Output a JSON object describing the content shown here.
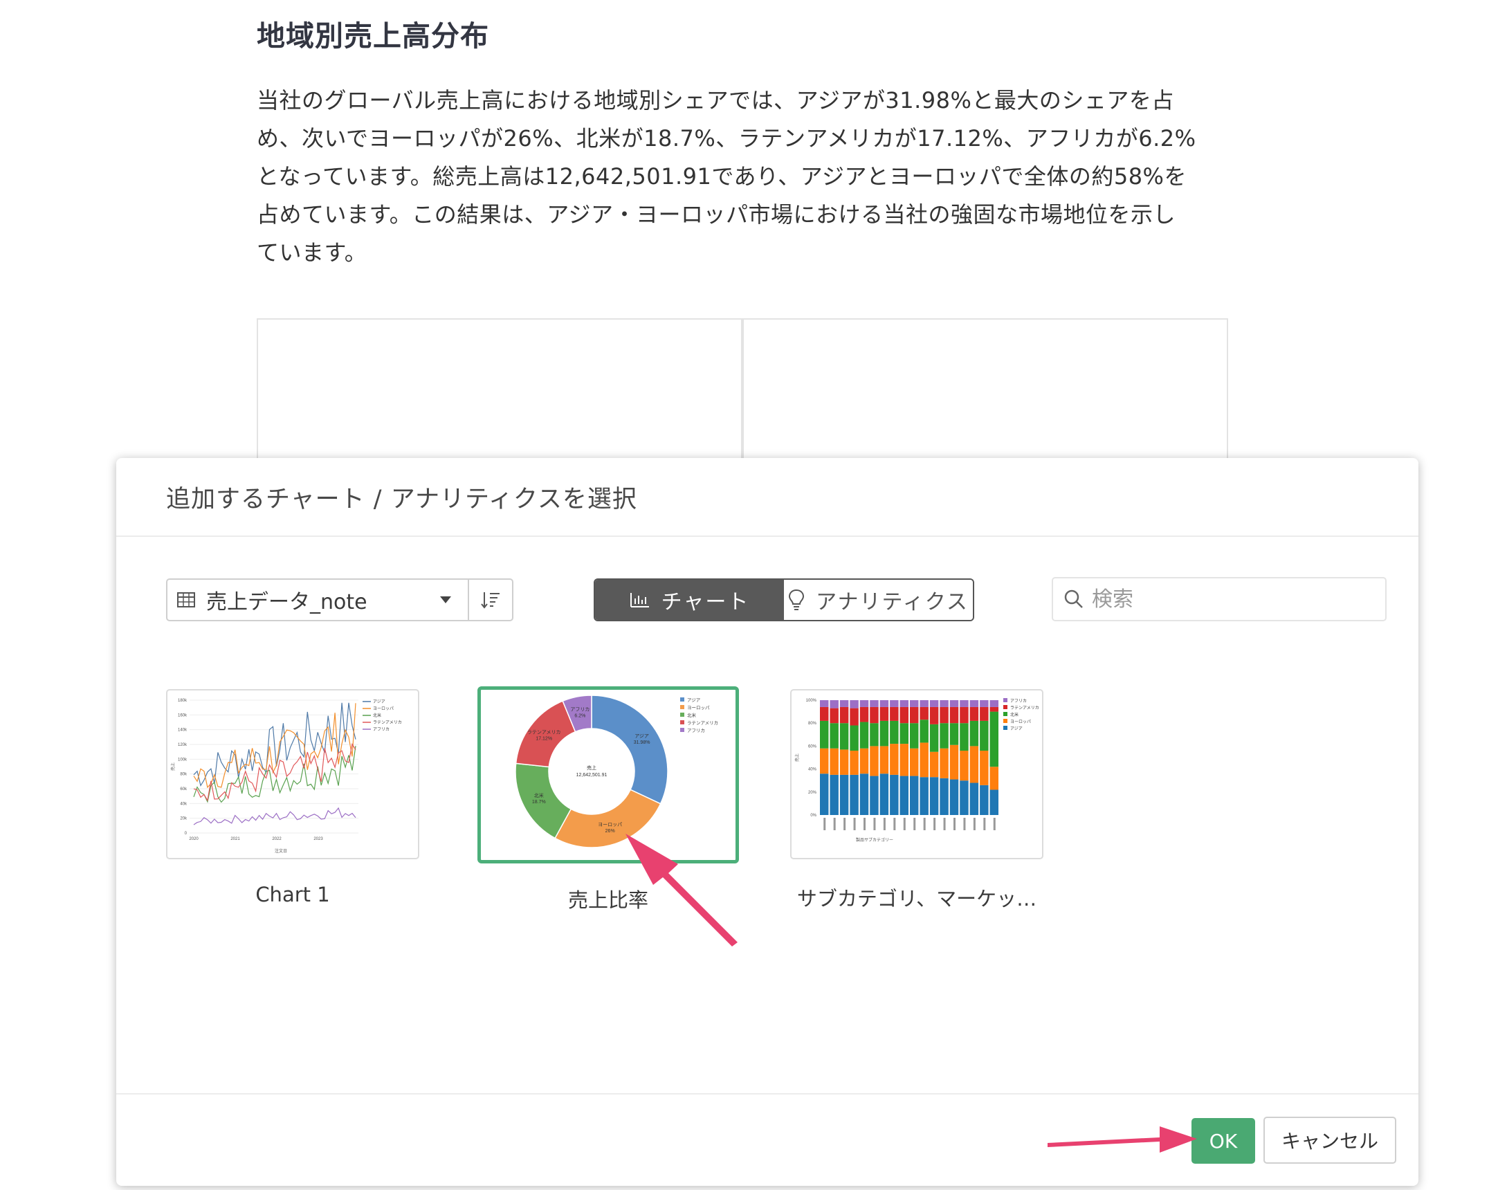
{
  "document": {
    "title": "地域別売上高分布",
    "paragraph_lines": [
      "当社のグローバル売上高における地域別シェアでは、アジアが31.98%と最大のシェアを占",
      "め、次いでヨーロッパが26%、北米が18.7%、ラテンアメリカが17.12%、アフリカが6.2%",
      "となっています。総売上高は12,642,501.91であり、アジアとヨーロッパで全体の約58%を",
      "占めています。この結果は、アジア・ヨーロッパ市場における当社の強固な市場地位を示し",
      "ています。"
    ]
  },
  "modal": {
    "title": "追加するチャート / アナリティクスを選択",
    "source": {
      "label": "売上データ_note",
      "icon": "table-icon"
    },
    "sort_icon": "sort-icon",
    "tabs": [
      {
        "label": "チャート",
        "icon": "bar-chart-icon",
        "active": true
      },
      {
        "label": "アナリティクス",
        "icon": "lightbulb-icon",
        "active": false
      }
    ],
    "search": {
      "placeholder": "検索",
      "value": "",
      "icon": "search-icon"
    },
    "cards": [
      {
        "label": "Chart 1",
        "selected": false
      },
      {
        "label": "売上比率",
        "selected": true
      },
      {
        "label": "サブカテゴリ、マーケッ…",
        "selected": false
      }
    ],
    "buttons": {
      "ok": "OK",
      "cancel": "キャンセル"
    },
    "colors": {
      "ok": "#4aa972",
      "selected_border": "#4caf7a",
      "arrow": "#e8416f"
    }
  },
  "chart_data": [
    {
      "type": "line",
      "x": [
        "2020",
        "2021",
        "2022",
        "2023"
      ],
      "xlabel": "注文日",
      "ylabel": "売上",
      "yticks": [
        "0",
        "20k",
        "40k",
        "60k",
        "80k",
        "100k",
        "120k",
        "140k",
        "160k",
        "180k"
      ],
      "series": [
        {
          "name": "アジア",
          "color": "#4e79a7"
        },
        {
          "name": "ヨーロッパ",
          "color": "#f28e2b"
        },
        {
          "name": "北米",
          "color": "#59a14f"
        },
        {
          "name": "ラテンアメリカ",
          "color": "#e15759"
        },
        {
          "name": "アフリカ",
          "color": "#9c6fc5"
        }
      ]
    },
    {
      "type": "pie",
      "center_label": "売上",
      "center_value": "12,642,501.91",
      "slices": [
        {
          "name": "アジア",
          "value": 31.98,
          "label": "31.98%",
          "color": "#5b8fc9"
        },
        {
          "name": "ヨーロッパ",
          "value": 26,
          "label": "26%",
          "color": "#f39c4b"
        },
        {
          "name": "北米",
          "value": 18.7,
          "label": "18.7%",
          "color": "#67ae5c"
        },
        {
          "name": "ラテンアメリカ",
          "value": 17.12,
          "label": "17.12%",
          "color": "#d95154"
        },
        {
          "name": "アフリカ",
          "value": 6.2,
          "label": "6.2%",
          "color": "#a27ac8"
        }
      ]
    },
    {
      "type": "bar",
      "stacked": true,
      "xlabel": "製品サブカテゴリー",
      "ylabel": "売上",
      "yticks": [
        "0%",
        "20%",
        "40%",
        "60%",
        "80%",
        "100%"
      ],
      "series": [
        {
          "name": "アフリカ",
          "color": "#9c6fc5"
        },
        {
          "name": "ラテンアメリカ",
          "color": "#d62728"
        },
        {
          "name": "北米",
          "color": "#2ca02c"
        },
        {
          "name": "ヨーロッパ",
          "color": "#ff7f0e"
        },
        {
          "name": "アジア",
          "color": "#1f77b4"
        }
      ],
      "stacks": [
        [
          36,
          22,
          24,
          12,
          6
        ],
        [
          35,
          23,
          22,
          13,
          7
        ],
        [
          35,
          22,
          23,
          14,
          6
        ],
        [
          35,
          21,
          22,
          15,
          7
        ],
        [
          36,
          22,
          23,
          13,
          6
        ],
        [
          34,
          26,
          20,
          14,
          6
        ],
        [
          36,
          24,
          22,
          12,
          6
        ],
        [
          35,
          27,
          20,
          12,
          6
        ],
        [
          34,
          28,
          18,
          14,
          6
        ],
        [
          34,
          24,
          22,
          14,
          6
        ],
        [
          33,
          30,
          20,
          11,
          6
        ],
        [
          33,
          22,
          24,
          15,
          6
        ],
        [
          32,
          26,
          22,
          14,
          6
        ],
        [
          31,
          30,
          19,
          14,
          6
        ],
        [
          30,
          26,
          24,
          14,
          6
        ],
        [
          28,
          32,
          22,
          12,
          6
        ],
        [
          26,
          30,
          26,
          12,
          6
        ],
        [
          22,
          20,
          48,
          4,
          6
        ]
      ]
    }
  ]
}
